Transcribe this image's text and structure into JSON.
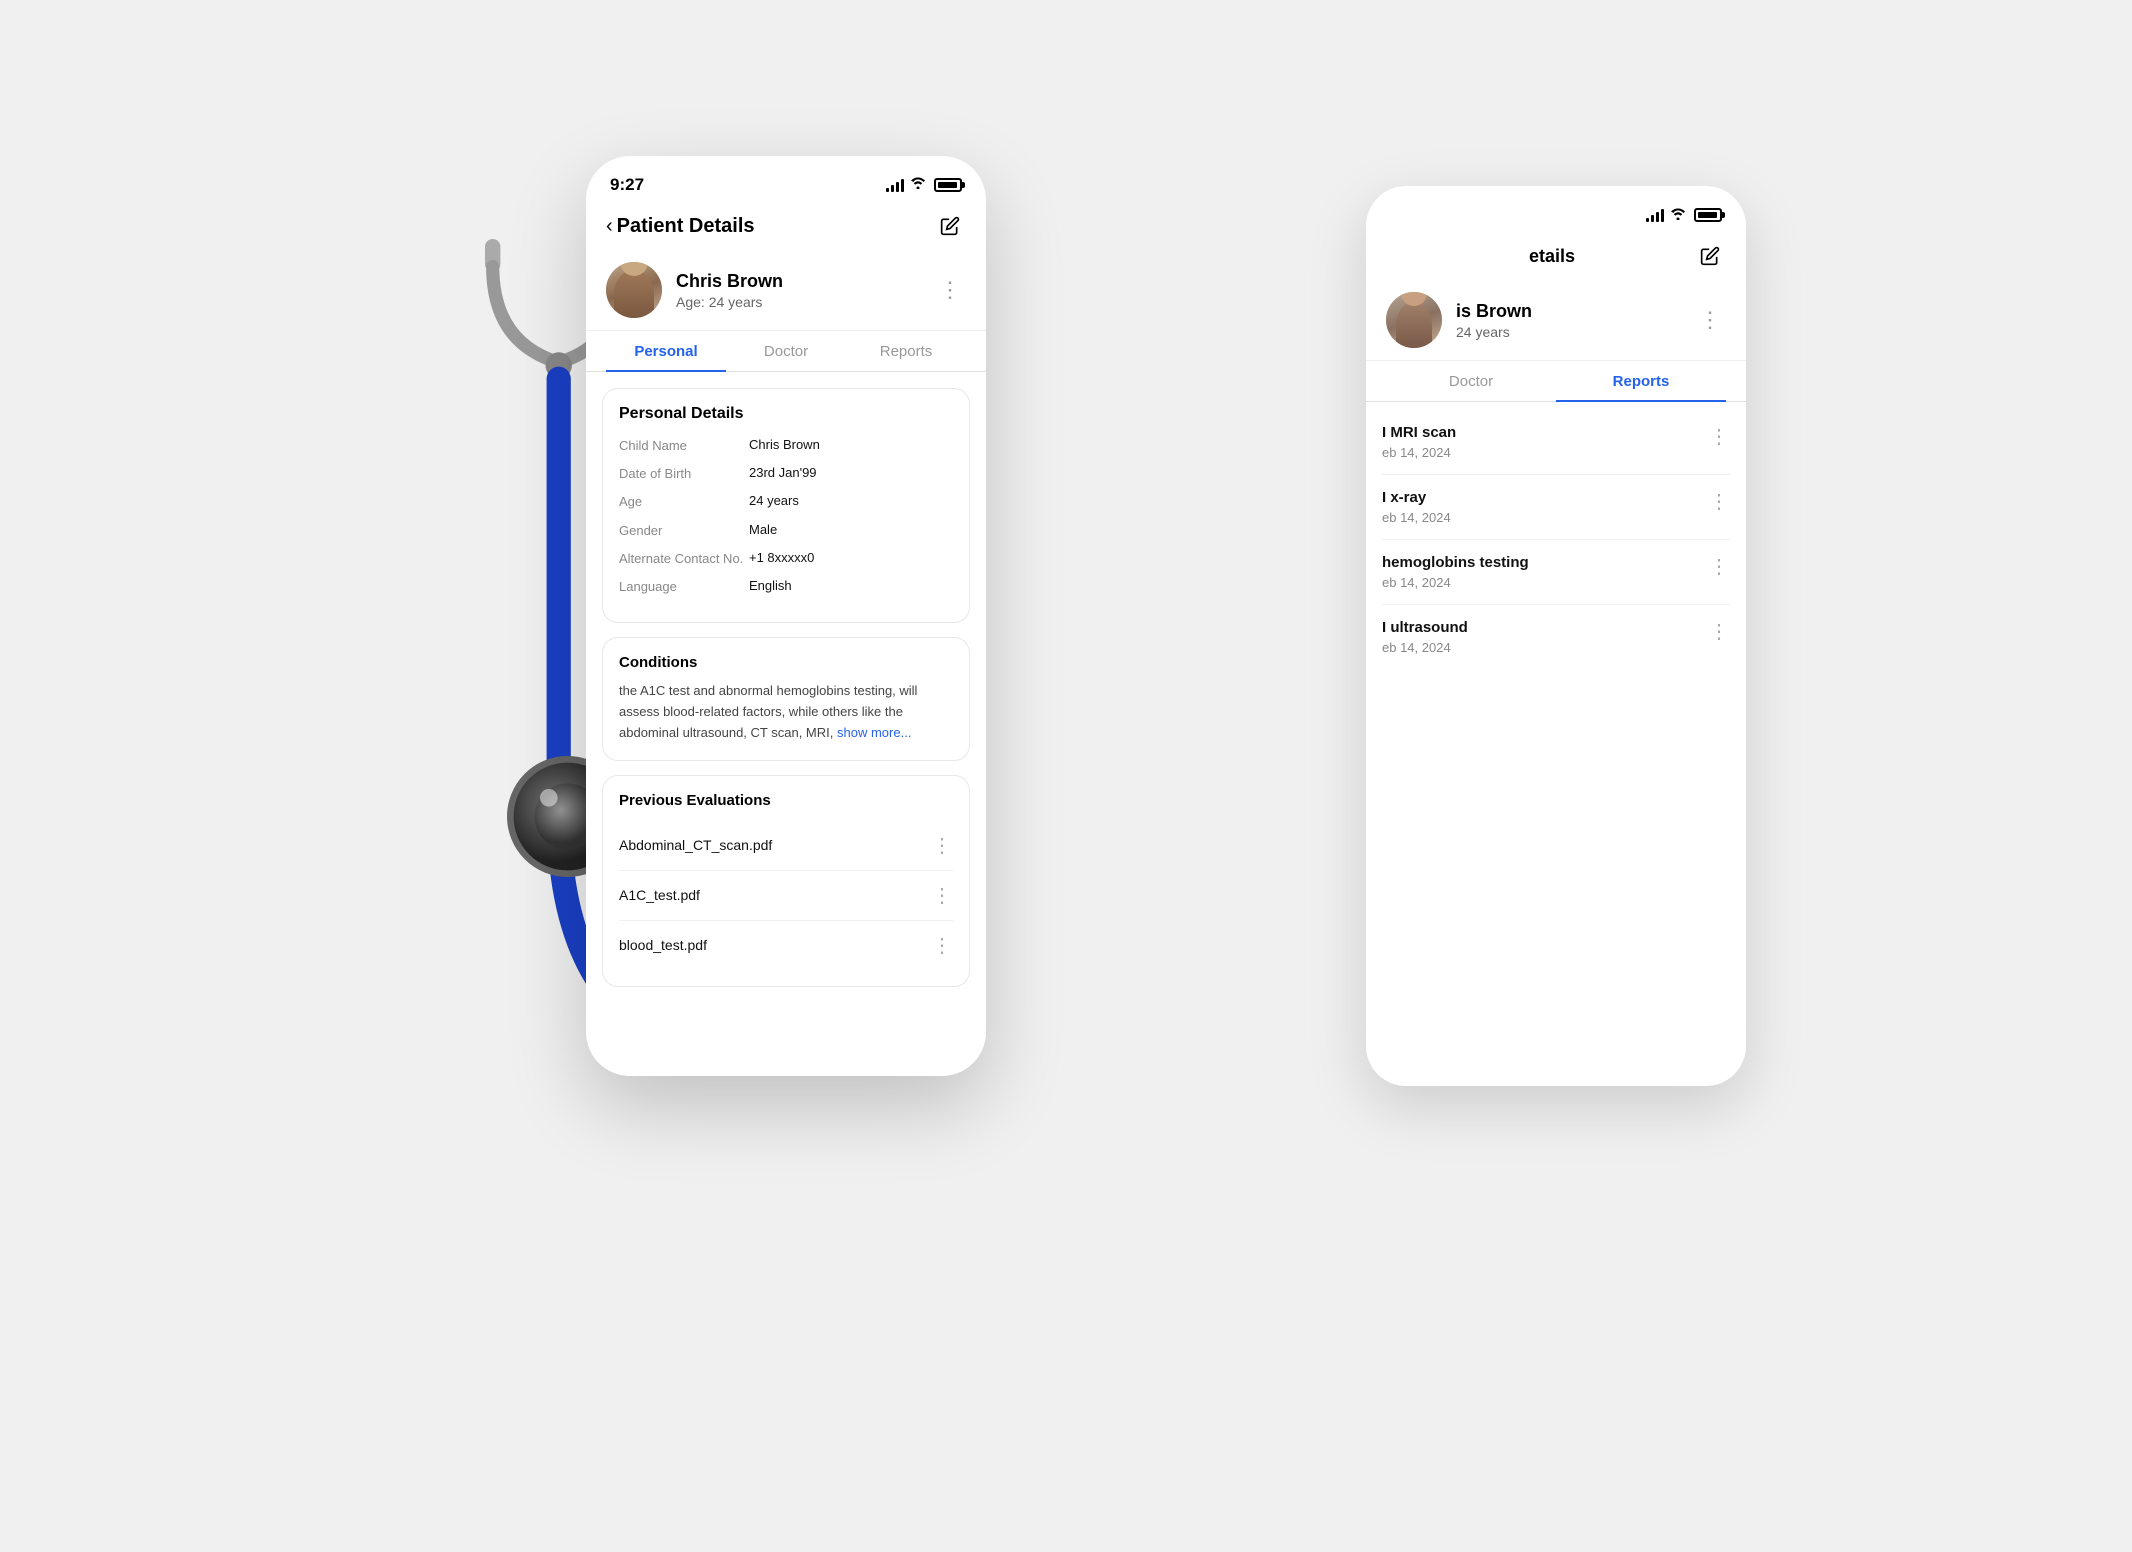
{
  "scene": {
    "background_color": "#f2f2f2"
  },
  "phone_fg": {
    "status": {
      "time": "9:27"
    },
    "header": {
      "back_label": "Patient Details",
      "edit_icon": "pencil"
    },
    "patient": {
      "name": "Chris Brown",
      "age_label": "Age: 24 years",
      "more_icon": "ellipsis"
    },
    "tabs": [
      {
        "id": "personal",
        "label": "Personal",
        "active": true
      },
      {
        "id": "doctor",
        "label": "Doctor",
        "active": false
      },
      {
        "id": "reports",
        "label": "Reports",
        "active": false
      }
    ],
    "personal_details": {
      "section_title": "Personal Details",
      "fields": [
        {
          "label": "Child Name",
          "value": "Chris Brown"
        },
        {
          "label": "Date of Birth",
          "value": "23rd Jan'99"
        },
        {
          "label": "Age",
          "value": "24 years"
        },
        {
          "label": "Gender",
          "value": "Male"
        },
        {
          "label": "Alternate Contact No.",
          "value": "+1 8xxxxx0"
        },
        {
          "label": "Language",
          "value": "English"
        }
      ]
    },
    "conditions": {
      "title": "Conditions",
      "text": "the A1C test and abnormal hemoglobins testing, will assess blood-related factors, while others like the abdominal ultrasound, CT scan, MRI,",
      "show_more": "show more..."
    },
    "previous_evaluations": {
      "title": "Previous Evaluations",
      "items": [
        {
          "name": "Abdominal_CT_scan.pdf"
        },
        {
          "name": "A1C_test.pdf"
        },
        {
          "name": "blood_test.pdf"
        }
      ]
    }
  },
  "phone_bg": {
    "header": {
      "partial_title": "etails",
      "edit_icon": "pencil"
    },
    "patient": {
      "partial_name": "is Brown",
      "partial_age": "24 years",
      "more_icon": "ellipsis"
    },
    "tabs": [
      {
        "id": "doctor",
        "label": "Doctor",
        "active": false
      },
      {
        "id": "reports",
        "label": "Reports",
        "active": true
      }
    ],
    "reports": [
      {
        "name": "I MRI scan",
        "date": "eb 14, 2024"
      },
      {
        "name": "I x-ray",
        "date": "eb 14, 2024"
      },
      {
        "name": "hemoglobins testing",
        "date": "eb 14, 2024"
      },
      {
        "name": "I ultrasound",
        "date": "eb 14, 2024"
      }
    ]
  },
  "icons": {
    "back_chevron": "‹",
    "pencil": "✏",
    "more_vert": "⋮",
    "signal_bars": "▂▄▆█",
    "wifi": "wifi",
    "battery_full": "battery"
  }
}
